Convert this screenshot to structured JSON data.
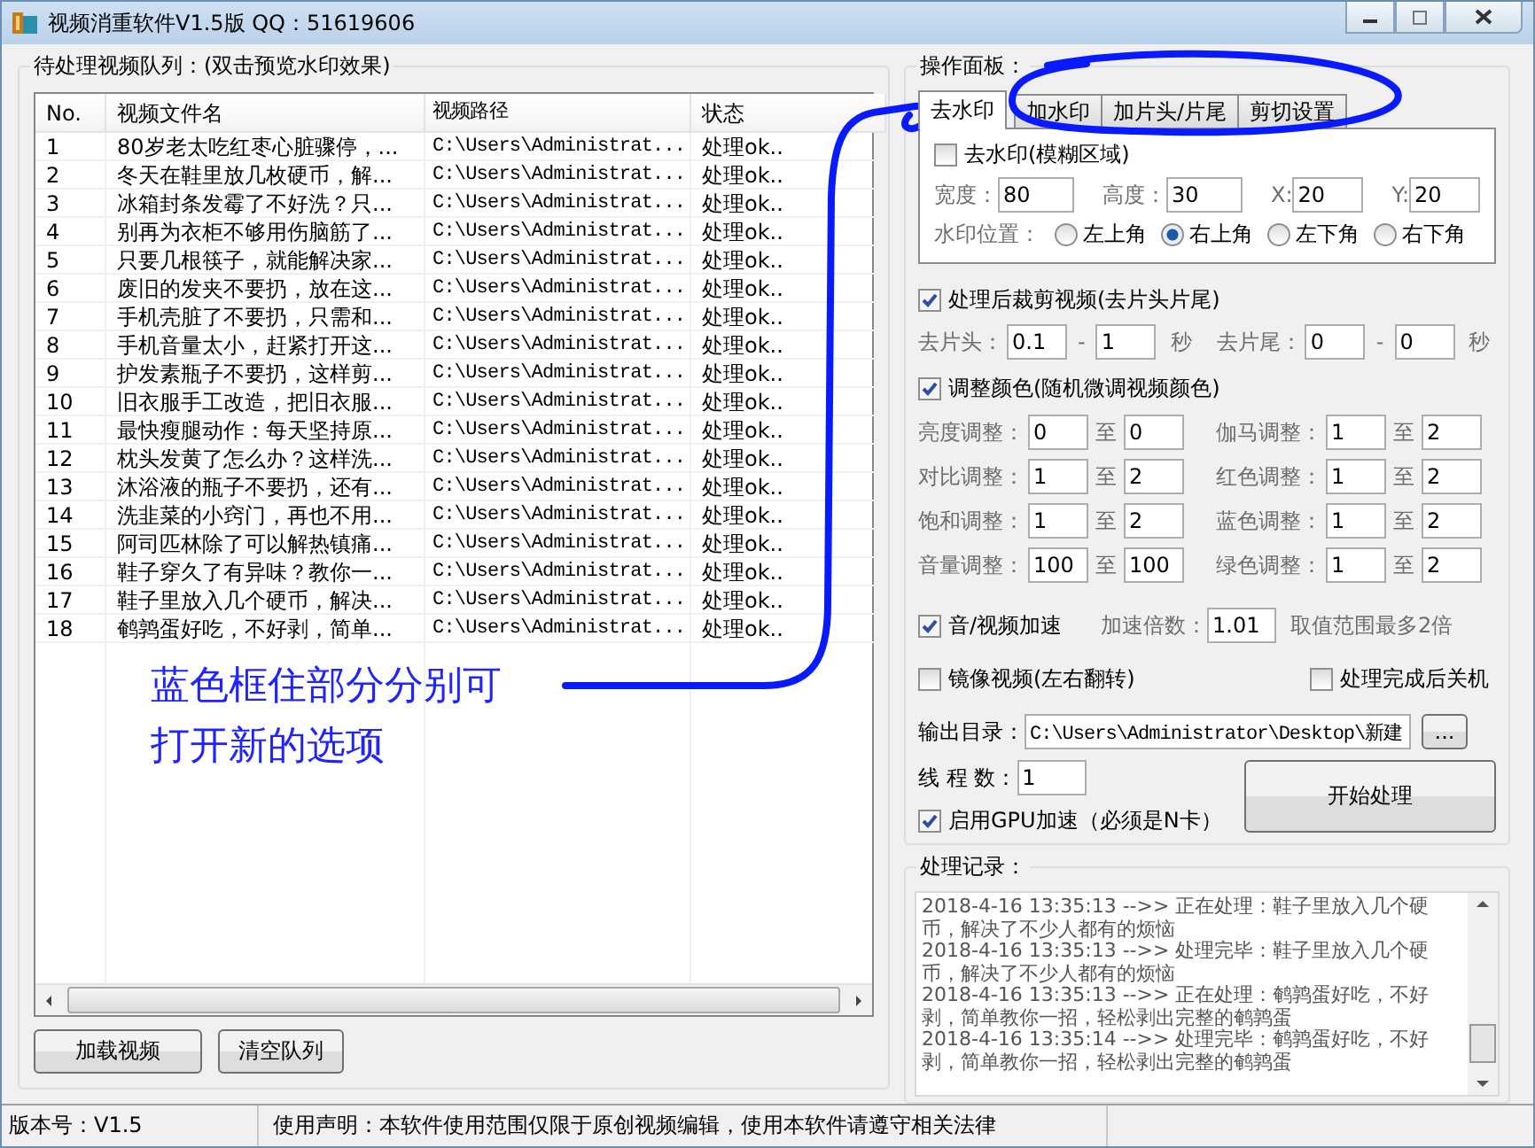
{
  "window": {
    "title": "视频消重软件V1.5版 QQ：51619606"
  },
  "queue": {
    "legend": "待处理视频队列：(双击预览水印效果)",
    "columns": [
      "No.",
      "视频文件名",
      "视频路径",
      "状态"
    ],
    "rows": [
      {
        "no": "1",
        "name": "80岁老太吃红枣心脏骤停，...",
        "path": "C:\\Users\\Administrat...",
        "status": "处理ok.."
      },
      {
        "no": "2",
        "name": "冬天在鞋里放几枚硬币，解...",
        "path": "C:\\Users\\Administrat...",
        "status": "处理ok.."
      },
      {
        "no": "3",
        "name": "冰箱封条发霉了不好洗？只...",
        "path": "C:\\Users\\Administrat...",
        "status": "处理ok.."
      },
      {
        "no": "4",
        "name": "别再为衣柜不够用伤脑筋了...",
        "path": "C:\\Users\\Administrat...",
        "status": "处理ok.."
      },
      {
        "no": "5",
        "name": "只要几根筷子，就能解决家...",
        "path": "C:\\Users\\Administrat...",
        "status": "处理ok.."
      },
      {
        "no": "6",
        "name": "废旧的发夹不要扔，放在这...",
        "path": "C:\\Users\\Administrat...",
        "status": "处理ok.."
      },
      {
        "no": "7",
        "name": "手机壳脏了不要扔，只需和...",
        "path": "C:\\Users\\Administrat...",
        "status": "处理ok.."
      },
      {
        "no": "8",
        "name": "手机音量太小，赶紧打开这...",
        "path": "C:\\Users\\Administrat...",
        "status": "处理ok.."
      },
      {
        "no": "9",
        "name": "护发素瓶子不要扔，这样剪...",
        "path": "C:\\Users\\Administrat...",
        "status": "处理ok.."
      },
      {
        "no": "10",
        "name": "旧衣服手工改造，把旧衣服...",
        "path": "C:\\Users\\Administrat...",
        "status": "处理ok.."
      },
      {
        "no": "11",
        "name": "最快瘦腿动作：每天坚持原...",
        "path": "C:\\Users\\Administrat...",
        "status": "处理ok.."
      },
      {
        "no": "12",
        "name": "枕头发黄了怎么办？这样洗...",
        "path": "C:\\Users\\Administrat...",
        "status": "处理ok.."
      },
      {
        "no": "13",
        "name": "沐浴液的瓶子不要扔，还有...",
        "path": "C:\\Users\\Administrat...",
        "status": "处理ok.."
      },
      {
        "no": "14",
        "name": "洗韭菜的小窍门，再也不用...",
        "path": "C:\\Users\\Administrat...",
        "status": "处理ok.."
      },
      {
        "no": "15",
        "name": "阿司匹林除了可以解热镇痛...",
        "path": "C:\\Users\\Administrat...",
        "status": "处理ok.."
      },
      {
        "no": "16",
        "name": "鞋子穿久了有异味？教你一...",
        "path": "C:\\Users\\Administrat...",
        "status": "处理ok.."
      },
      {
        "no": "17",
        "name": "鞋子里放入几个硬币，解决...",
        "path": "C:\\Users\\Administrat...",
        "status": "处理ok.."
      },
      {
        "no": "18",
        "name": "鹌鹑蛋好吃，不好剥，简单...",
        "path": "C:\\Users\\Administrat...",
        "status": "处理ok.."
      }
    ],
    "buttons": [
      "加载视频",
      "清空队列"
    ]
  },
  "annotation": {
    "lines": [
      "蓝色框住部分分别可",
      "打开新的选项"
    ]
  },
  "panel": {
    "legend": "操作面板：",
    "tabs": [
      {
        "label": "去水印",
        "selected": true
      },
      {
        "label": "加水印",
        "selected": false
      },
      {
        "label": "加片头/片尾",
        "selected": false
      },
      {
        "label": "剪切设置",
        "selected": false
      }
    ],
    "watermark": {
      "label": "去水印(模糊区域)",
      "checked": false,
      "fields": [
        {
          "label": "宽度：",
          "value": "80"
        },
        {
          "label": "高度：",
          "value": "30"
        },
        {
          "label": "X:",
          "value": "20"
        },
        {
          "label": "Y:",
          "value": "20"
        }
      ],
      "position_label": "水印位置：",
      "positions": [
        {
          "label": "左上角",
          "selected": false
        },
        {
          "label": "右上角",
          "selected": true
        },
        {
          "label": "左下角",
          "selected": false
        },
        {
          "label": "右下角",
          "selected": false
        }
      ]
    },
    "trim": {
      "label": "处理后裁剪视频(去片头片尾)",
      "checked": true,
      "parts": [
        {
          "label": "去片头：",
          "from": "0.1",
          "sep": "-",
          "to": "1",
          "unit": "秒"
        },
        {
          "label": "去片尾：",
          "from": "0",
          "sep": "-",
          "to": "0",
          "unit": "秒"
        }
      ]
    },
    "color": {
      "label": "调整颜色(随机微调视频颜色)",
      "checked": true,
      "rows": [
        {
          "label": "亮度调整：",
          "from": "0",
          "sep": "至",
          "to": "0"
        },
        {
          "label": "伽马调整：",
          "from": "1",
          "sep": "至",
          "to": "2"
        },
        {
          "label": "对比调整：",
          "from": "1",
          "sep": "至",
          "to": "2"
        },
        {
          "label": "红色调整：",
          "from": "1",
          "sep": "至",
          "to": "2"
        },
        {
          "label": "饱和调整：",
          "from": "1",
          "sep": "至",
          "to": "2"
        },
        {
          "label": "蓝色调整：",
          "from": "1",
          "sep": "至",
          "to": "2"
        },
        {
          "label": "音量调整：",
          "from": "100",
          "sep": "至",
          "to": "100"
        },
        {
          "label": "绿色调整：",
          "from": "1",
          "sep": "至",
          "to": "2"
        }
      ]
    },
    "speed": {
      "label": "音/视频加速",
      "checked": true,
      "factor_label": "加速倍数：",
      "factor": "1.01",
      "hint": "取值范围最多2倍"
    },
    "mirror": {
      "label": "镜像视频(左右翻转)",
      "checked": false
    },
    "shutdown": {
      "label": "处理完成后关机",
      "checked": false
    },
    "output": {
      "label": "输出目录：",
      "value": "C:\\Users\\Administrator\\Desktop\\新建",
      "browse": "..."
    },
    "threads": {
      "label": "线 程 数：",
      "value": "1"
    },
    "gpu": {
      "label": "启用GPU加速（必须是N卡）",
      "checked": true
    },
    "start": "开始处理"
  },
  "log": {
    "legend": "处理记录：",
    "entries": [
      "2018-4-16 13:35:13 -->> 正在处理：鞋子里放入几个硬币，解决了不少人都有的烦恼",
      "2018-4-16 13:35:13 -->> 处理完毕：鞋子里放入几个硬币，解决了不少人都有的烦恼",
      "2018-4-16 13:35:13 -->> 正在处理：鹌鹑蛋好吃，不好剥，简单教你一招，轻松剥出完整的鹌鹑蛋",
      "2018-4-16 13:35:14 -->> 处理完毕：鹌鹑蛋好吃，不好剥，简单教你一招，轻松剥出完整的鹌鹑蛋"
    ]
  },
  "status_bar": [
    "版本号：V1.5",
    "使用声明：本软件使用范围仅限于原创视频编辑，使用本软件请遵守相关法律"
  ]
}
